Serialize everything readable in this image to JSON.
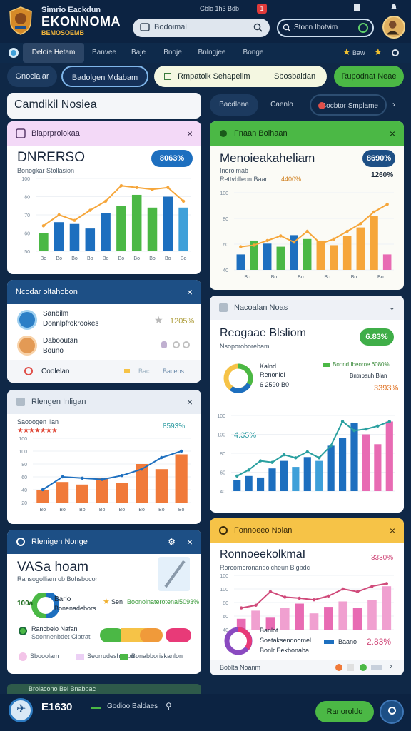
{
  "header": {
    "brand_subtitle": "Simrio Eackdun",
    "brand_title": "EKONNOMA",
    "brand_tagline": "BEMOSOEMB",
    "status_text": "Gblo  1h3 Bdb",
    "notif_count": "1",
    "search_placeholder": "Bodoimal",
    "search2_placeholder": "Stoon Ibotvim"
  },
  "nav": {
    "items": [
      "Deloie Hetam",
      "Banvee",
      "Baje",
      "Bnoje",
      "Bnlngjee",
      "Bonge"
    ],
    "right_label": "Baw"
  },
  "actions": {
    "a1": "Gnoclalar",
    "a2": "Badolgen Mdabam",
    "a3": "Rmpatolk Sehapelim",
    "a3b": "Sbosbaldan",
    "a4": "Rupodnat Neae"
  },
  "left": {
    "title": "Camdikil Nosiea",
    "card1": {
      "header": "Blaprprolokaa",
      "big": "DNRERSO",
      "sub": "Bonogkar Stollasion",
      "badge": "8063%"
    },
    "card2": {
      "header": "Ncodar oltahobon",
      "p1_name": "Sanbilm",
      "p1_sub": "Donnlpfrokrookes",
      "p1_val": "1205%",
      "p2_name": "Dabooutan",
      "p2_sub": "Bouno",
      "footer": "Coolelan",
      "footer_r": "Bacebs"
    },
    "card3": {
      "header": "Rlengen Inligan",
      "sub": "Saooogen Ilan",
      "pct": "8593%"
    },
    "card4": {
      "header": "Rlenigen Nonge",
      "big": "VASa hoam",
      "sub": "Ransogolliam ob Bohsbocor",
      "donut_val": "100a",
      "donut_lbl": "Barlo",
      "donut_sub": "Bonenadebors",
      "star_label": "Sen",
      "star_value": "Boonolnaterotenal5093%",
      "row2_a": "Rancbelo Nafan",
      "row2_b": "Soonnenbdet Ciptrat",
      "legend1": "Sbooolam",
      "legend2": "Seorrudeshdepn",
      "legend3": "Bonabboriskanlon"
    },
    "teaser": "Brolacono Bel Bnabbac"
  },
  "right": {
    "tabs": [
      "Bacdlone",
      "Caenlo",
      "Bocbtor Smplame"
    ],
    "card1": {
      "header": "Fnaan Bolhaan",
      "big": "Menoieakaheliam",
      "sub1": "Inorolmab",
      "sub2": "Rettvblleon Baan",
      "sub2_val": "4400%",
      "badge": "8690%",
      "pct": "1260%"
    },
    "card2": {
      "header": "Nacoalan Noas",
      "big": "Reogaae Blsliom",
      "sub": "Nsoporoborebam",
      "badge": "6.83%",
      "donut_lbl": "Kalnd",
      "donut_sub": "Renonlel",
      "donut_val": "6 2590 B0",
      "leg1": "Bonnd Ibeoroe 6080%",
      "leg2": "Bntnbauh Blan",
      "pct1": "3393%",
      "pct2": "4.35%"
    },
    "card3": {
      "header": "Fonnoeeo Nolan",
      "big": "RonnoeekolkmaI",
      "sub": "Rorcomoronandolcheun Bigbdc",
      "pct": "3330%",
      "donut_lbl": "Banlot",
      "donut_sub": "Soetaksendoomel",
      "donut_sub2": "Bonlr Eekbonaba",
      "leg": "Baano",
      "pct2": "2.83%",
      "footer": "Boblta Noanm"
    }
  },
  "bottom": {
    "value": "E1630",
    "label": "Godioo Baldaes",
    "cta": "Ranoroldo"
  },
  "colors": {
    "navy": "#0f2847",
    "green": "#4bb845",
    "blue": "#1d6fbf",
    "orange": "#f07a3a",
    "pink": "#e86bb3",
    "yellow": "#f6c347",
    "lavender": "#f3d9f7"
  },
  "chart_data": [
    {
      "type": "bar",
      "title": "DNRERSO",
      "categories": [
        "Bo",
        "Bo",
        "Bo",
        "Bo",
        "Bo",
        "Bo",
        "Bo",
        "Bo",
        "Bo",
        "Bo"
      ],
      "series": [
        {
          "values": [
            20,
            32,
            30,
            25,
            42,
            50,
            62,
            48,
            60,
            48
          ]
        }
      ],
      "line": [
        28,
        40,
        34,
        45,
        55,
        72,
        70,
        68,
        70,
        55
      ],
      "ylim": [
        0,
        80
      ],
      "yticks": [
        "100",
        "80",
        "70",
        "60",
        "50"
      ]
    },
    {
      "type": "bar",
      "title": "Menoieakaheliam",
      "categories": [
        "Bo",
        "Bo",
        "Bo",
        "Bo",
        "Bo",
        "Bo"
      ],
      "series": [
        {
          "values": [
            20,
            38,
            34,
            30,
            45,
            40,
            38,
            32,
            44,
            55,
            70,
            20
          ]
        }
      ],
      "line": [
        30,
        32,
        38,
        44,
        36,
        50,
        34,
        40,
        50,
        60,
        75,
        85
      ],
      "ylim": [
        0,
        100
      ],
      "yticks": [
        "100",
        "80",
        "60",
        "40"
      ]
    },
    {
      "type": "bar",
      "title": "Saooogen Ilan",
      "categories": [
        "Bo",
        "Bo",
        "Bo",
        "Bo",
        "Bo",
        "Bo",
        "Bo",
        "Bo"
      ],
      "series": [
        {
          "values": [
            20,
            32,
            28,
            38,
            30,
            60,
            52,
            75
          ]
        }
      ],
      "line": [
        20,
        40,
        38,
        36,
        42,
        52,
        70,
        80
      ],
      "ylim": [
        0,
        100
      ],
      "yticks": [
        "100",
        "100",
        "80",
        "60",
        "40",
        "20"
      ]
    },
    {
      "type": "bar",
      "title": "Reogaae Blsliom",
      "categories": [],
      "series": [
        {
          "values": [
            15,
            20,
            18,
            30,
            40,
            32,
            45,
            40,
            60,
            70,
            90,
            75,
            62,
            92
          ]
        }
      ],
      "line": [
        20,
        28,
        40,
        38,
        48,
        44,
        52,
        44,
        60,
        92,
        80,
        82,
        86,
        92
      ],
      "ylim": [
        0,
        100
      ],
      "yticks": [
        "100",
        "100",
        "80",
        "60",
        "40"
      ]
    },
    {
      "type": "bar",
      "title": "RonnoeekolkmaI",
      "categories": [],
      "series": [
        {
          "values": [
            20,
            35,
            22,
            40,
            48,
            30,
            42,
            52,
            40,
            55,
            80
          ]
        }
      ],
      "line": [
        40,
        45,
        70,
        60,
        58,
        55,
        62,
        75,
        70,
        80,
        85
      ],
      "ylim": [
        0,
        100
      ],
      "yticks": [
        "100",
        "100",
        "80",
        "60",
        "40"
      ]
    }
  ]
}
